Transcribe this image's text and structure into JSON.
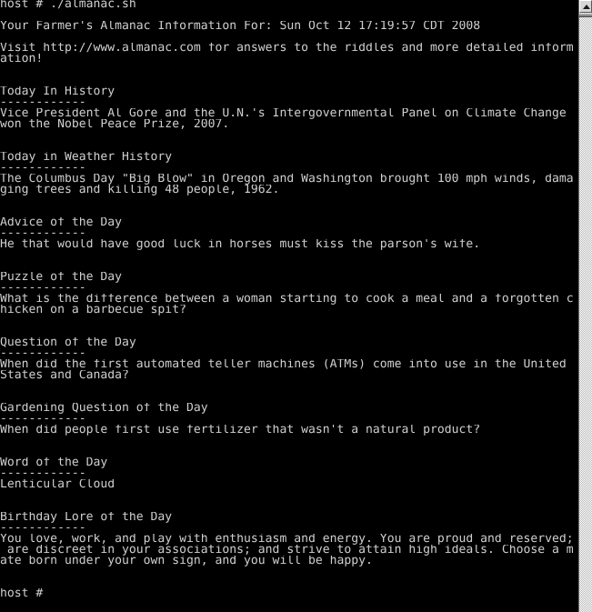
{
  "terminal": {
    "background_color": "#000000",
    "text_color": "#cfcfcf",
    "columns": 80,
    "prompt": "host # ",
    "command": "./almanac.sh",
    "lines": [
      "host # ./almanac.sh",
      "",
      "Your Farmer's Almanac Information For: Sun Oct 12 17:19:57 CDT 2008",
      "",
      "Visit http://www.almanac.com for answers to the riddles and more detailed inform",
      "ation!",
      "",
      "",
      "Today In History",
      "------------",
      "Vice President Al Gore and the U.N.'s Intergovernmental Panel on Climate Change",
      "won the Nobel Peace Prize, 2007.",
      "",
      "",
      "Today in Weather History",
      "------------",
      "The Columbus Day \"Big Blow\" in Oregon and Washington brought 100 mph winds, dama",
      "ging trees and killing 48 people, 1962.",
      "",
      "",
      "Advice of the Day",
      "------------",
      "He that would have good luck in horses must kiss the parson's wife.",
      "",
      "",
      "Puzzle of the Day",
      "------------",
      "What is the difference between a woman starting to cook a meal and a forgotten c",
      "hicken on a barbecue spit?",
      "",
      "",
      "Question of the Day",
      "------------",
      "When did the first automated teller machines (ATMs) come into use in the United",
      "States and Canada?",
      "",
      "",
      "Gardening Question of the Day",
      "------------",
      "When did people first use fertilizer that wasn't a natural product?",
      "",
      "",
      "Word of the Day",
      "------------",
      "Lenticular Cloud",
      "",
      "",
      "Birthday Lore of the Day",
      "------------",
      "You love, work, and play with enthusiasm and energy. You are proud and reserved;",
      " are discreet in your associations; and strive to attain high ideals. Choose a m",
      "ate born under your own sign, and you will be happy.",
      "",
      "",
      "host # "
    ],
    "sections": [
      {
        "heading": "Today In History",
        "body": "Vice President Al Gore and the U.N.'s Intergovernmental Panel on Climate Change won the Nobel Peace Prize, 2007."
      },
      {
        "heading": "Today in Weather History",
        "body": "The Columbus Day \"Big Blow\" in Oregon and Washington brought 100 mph winds, damaging trees and killing 48 people, 1962."
      },
      {
        "heading": "Advice of the Day",
        "body": "He that would have good luck in horses must kiss the parson's wife."
      },
      {
        "heading": "Puzzle of the Day",
        "body": "What is the difference between a woman starting to cook a meal and a forgotten chicken on a barbecue spit?"
      },
      {
        "heading": "Question of the Day",
        "body": "When did the first automated teller machines (ATMs) come into use in the United States and Canada?"
      },
      {
        "heading": "Gardening Question of the Day",
        "body": "When did people first use fertilizer that wasn't a natural product?"
      },
      {
        "heading": "Word of the Day",
        "body": "Lenticular Cloud"
      },
      {
        "heading": "Birthday Lore of the Day",
        "body": "You love, work, and play with enthusiasm and energy. You are proud and reserved; are discreet in your associations; and strive to attain high ideals. Choose a mate born under your own sign, and you will be happy."
      }
    ],
    "header": {
      "title": "Your Farmer's Almanac Information For: Sun Oct 12 17:19:57 CDT 2008",
      "date": "Sun Oct 12 17:19:57 CDT 2008",
      "visit_note": "Visit http://www.almanac.com for answers to the riddles and more detailed information!",
      "url": "http://www.almanac.com"
    }
  },
  "scrollbar": {
    "up_arrow_icon": "triangle-up-icon",
    "thumb_position_percent": 2,
    "orientation": "vertical"
  }
}
